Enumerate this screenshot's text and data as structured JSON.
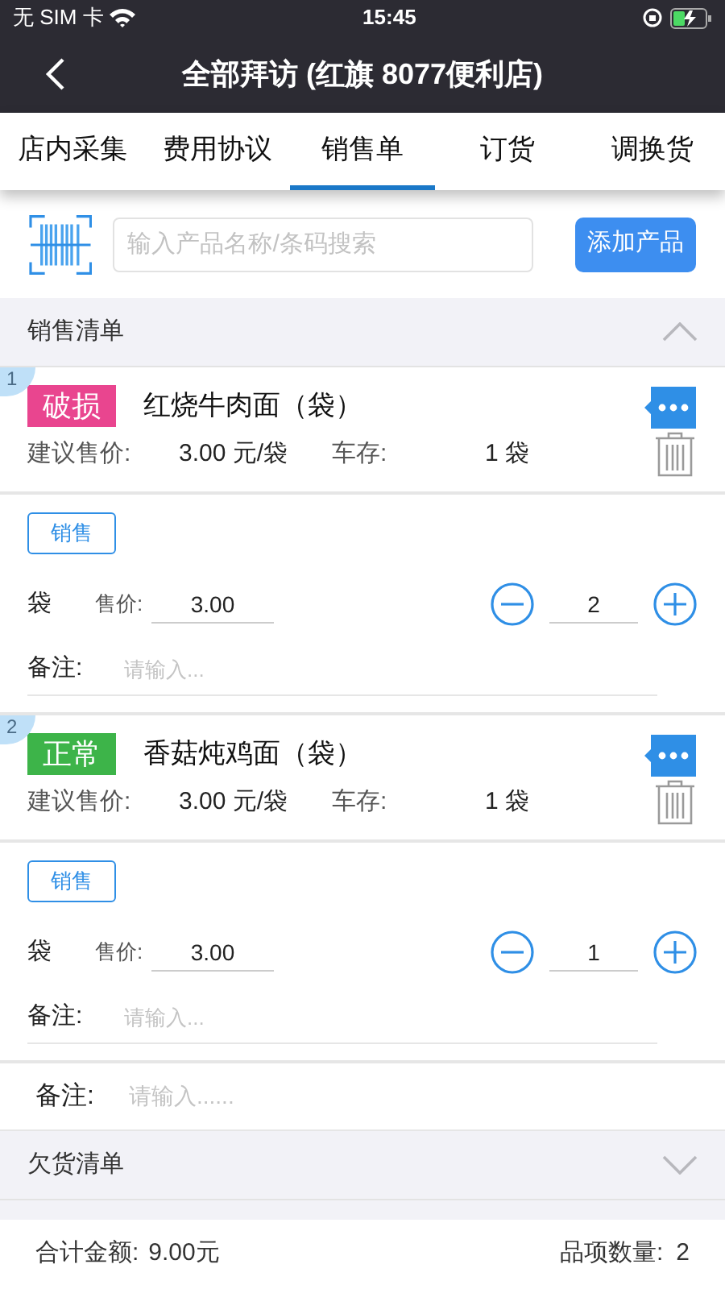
{
  "status_bar": {
    "carrier": "无 SIM 卡",
    "time": "15:45"
  },
  "nav": {
    "title": "全部拜访 (红旗 8077便利店)"
  },
  "tabs": [
    {
      "label": "店内采集",
      "selected": false
    },
    {
      "label": "费用协议",
      "selected": false
    },
    {
      "label": "销售单",
      "selected": true
    },
    {
      "label": "订货",
      "selected": false
    },
    {
      "label": "调换货",
      "selected": false
    }
  ],
  "search": {
    "placeholder": "输入产品名称/条码搜索",
    "add_button": "添加产品"
  },
  "sales_section": {
    "title": "销售清单",
    "expanded": true
  },
  "items": [
    {
      "index": "1",
      "tag": "破损",
      "color": "#e9458f",
      "name": "红烧牛肉面（袋）",
      "price_label": "建议售价:",
      "price": "3.00 元/袋",
      "stock_label": "车存:",
      "stock": "1 袋",
      "mode_button": "销售",
      "unit": "袋",
      "sale_price_label": "售价:",
      "sale_price": "3.00",
      "quantity": "2",
      "note_label": "备注:",
      "note_placeholder": "请输入..."
    },
    {
      "index": "2",
      "tag": "正常",
      "color": "#3db449",
      "name": "香菇炖鸡面（袋）",
      "price_label": "建议售价:",
      "price": "3.00 元/袋",
      "stock_label": "车存:",
      "stock": "1 袋",
      "mode_button": "销售",
      "unit": "袋",
      "sale_price_label": "售价:",
      "sale_price": "3.00",
      "quantity": "1",
      "note_label": "备注:",
      "note_placeholder": "请输入..."
    }
  ],
  "order_note": {
    "label": "备注:",
    "placeholder": "请输入......"
  },
  "backorder_section": {
    "title": "欠货清单",
    "expanded": false
  },
  "footer": {
    "total_label": "合计金额:",
    "total": "9.00元",
    "count_label": "品项数量:",
    "count": "2"
  }
}
